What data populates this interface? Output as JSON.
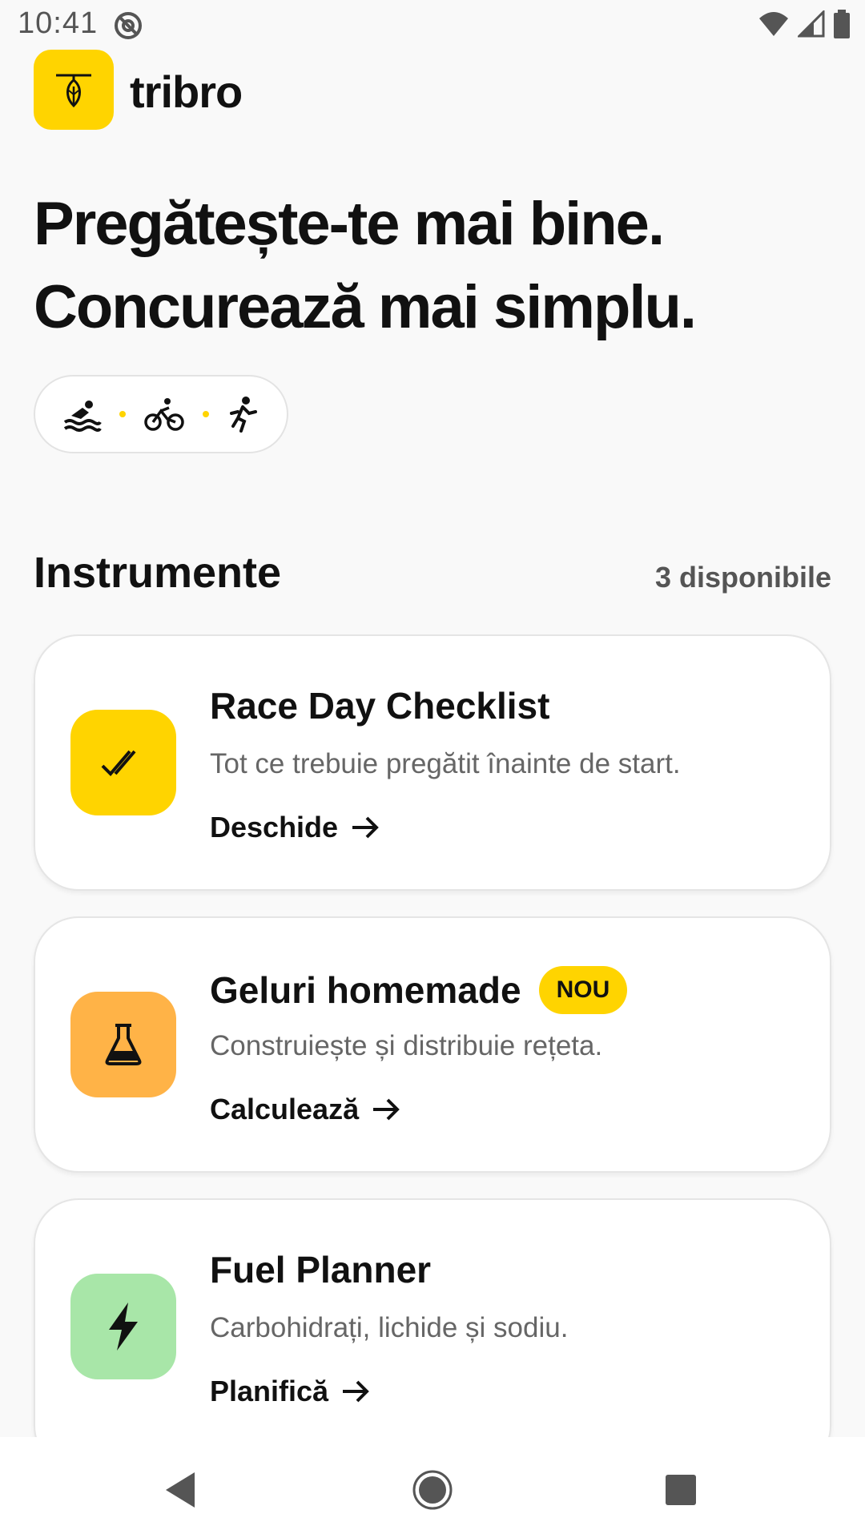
{
  "status_bar": {
    "time": "10:41",
    "icons": [
      "at-sign-icon",
      "wifi-icon",
      "signal-icon",
      "battery-icon"
    ]
  },
  "header": {
    "brand": "tribro",
    "logo_icon": "leaf-pendant-icon",
    "logo_color": "#ffd400"
  },
  "hero": {
    "line1": "Pregătește-te mai bine.",
    "line2": "Concurează mai simplu.",
    "sports": [
      "swim-icon",
      "bike-icon",
      "run-icon"
    ]
  },
  "tools": {
    "title": "Instrumente",
    "count": "3 disponibile",
    "items": [
      {
        "title": "Race Day Checklist",
        "description": "Tot ce trebuie pregătit înainte de start.",
        "action": "Deschide",
        "icon": "double-check-icon",
        "color": "#ffd400"
      },
      {
        "title": "Geluri homemade",
        "badge": "NOU",
        "description": "Construiește și distribuie rețeta.",
        "action": "Calculează",
        "icon": "flask-icon",
        "color": "#ffb347"
      },
      {
        "title": "Fuel Planner",
        "description": "Carbohidrați, lichide și sodiu.",
        "action": "Planifică",
        "icon": "lightning-icon",
        "color": "#a8e6a8"
      }
    ]
  },
  "nav": {
    "buttons": [
      "back-icon",
      "home-icon",
      "recents-icon"
    ]
  }
}
